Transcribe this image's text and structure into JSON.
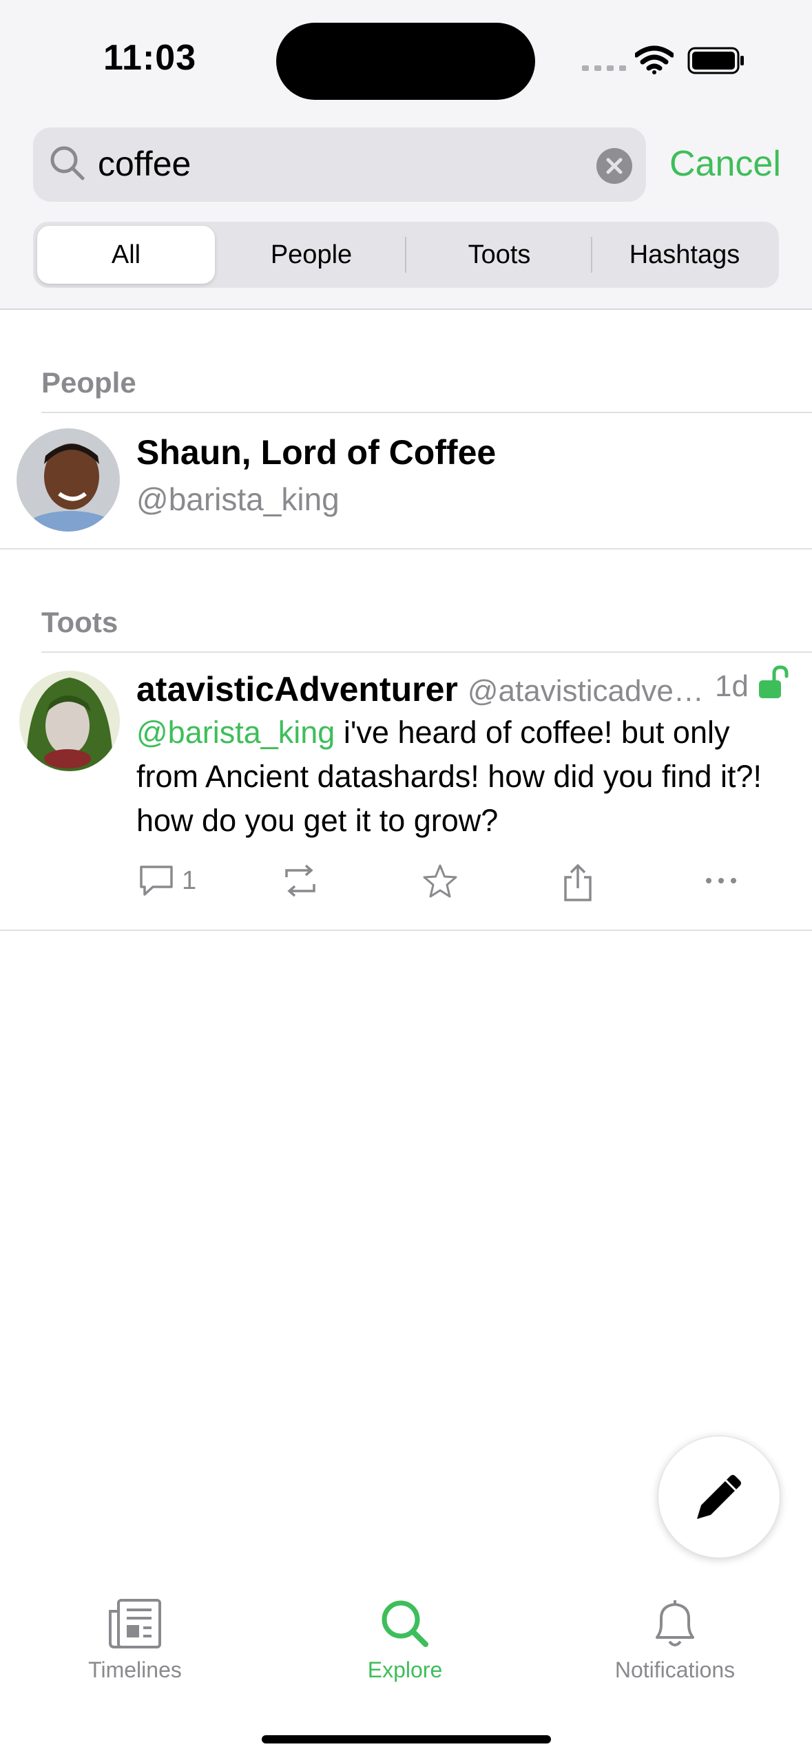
{
  "status_bar": {
    "time": "11:03"
  },
  "search": {
    "value": "coffee",
    "cancel_label": "Cancel"
  },
  "filters": {
    "tabs": [
      "All",
      "People",
      "Toots",
      "Hashtags"
    ],
    "selected": "All"
  },
  "people_section": {
    "label": "People",
    "items": [
      {
        "display_name": "Shaun, Lord of Coffee",
        "handle": "@barista_king"
      }
    ]
  },
  "toots_section": {
    "label": "Toots",
    "items": [
      {
        "author": "atavisticAdventurer",
        "handle": "@atavisticadve…",
        "time": "1d",
        "mention": "@barista_king",
        "text": " i've heard of coffee! but only from Ancient datashards! how did you find it?! how do you get it to grow?",
        "reply_count": "1"
      }
    ]
  },
  "tab_bar": {
    "items": [
      {
        "label": "Timelines",
        "icon": "newspaper-icon"
      },
      {
        "label": "Explore",
        "icon": "search-icon"
      },
      {
        "label": "Notifications",
        "icon": "bell-icon"
      }
    ],
    "selected": "Explore"
  },
  "colors": {
    "accent": "#3ebe5a",
    "secondary_text": "#8a8a8e",
    "background": "#ffffff"
  }
}
